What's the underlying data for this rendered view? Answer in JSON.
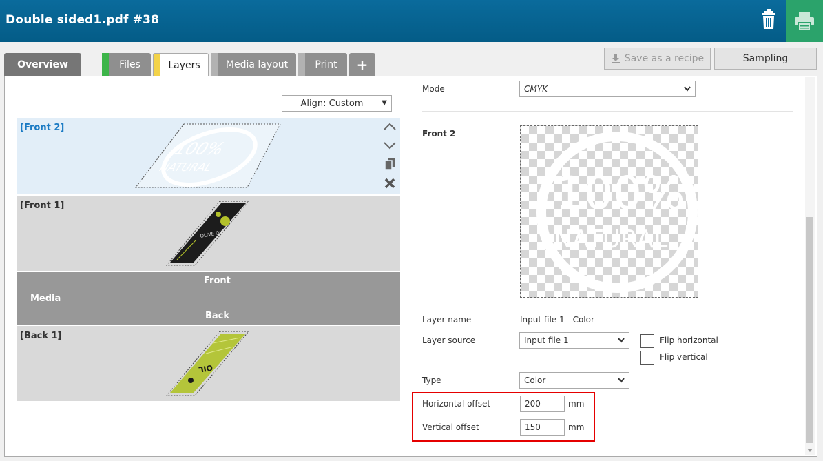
{
  "app": {
    "title": "Double sided1.pdf #38"
  },
  "header": {
    "trash_icon": "trash-icon",
    "print_icon": "printer-icon"
  },
  "tabs": [
    {
      "label": "Overview"
    },
    {
      "label": "Files",
      "color": "#3db54a"
    },
    {
      "label": "Layers",
      "color": "#f3d34a"
    },
    {
      "label": "Media layout",
      "color": "#9b9b9b"
    },
    {
      "label": "Print",
      "color": "#9b9b9b"
    },
    {
      "label": "+"
    }
  ],
  "toolbar": {
    "save_recipe": "Save as a recipe",
    "sampling": "Sampling"
  },
  "left": {
    "align": "Align: Custom",
    "layers": [
      {
        "name": "[Front 2]",
        "selected": true
      },
      {
        "name": "[Front 1]"
      },
      {
        "name": "[Back 1]"
      }
    ],
    "media": {
      "front": "Front",
      "media": "Media",
      "back": "Back"
    },
    "artwork": {
      "natural": "NATURAL",
      "percent": "100%",
      "olive": "OLIVE OIL",
      "olive_back": "OIL"
    }
  },
  "right": {
    "mode_label": "Mode",
    "mode_value": "CMYK",
    "section_title": "Front 2",
    "preview_text_1": "100%",
    "preview_text_2": "NATURAL",
    "layer_name_label": "Layer name",
    "layer_name_value": "Input file 1 - Color",
    "layer_source_label": "Layer source",
    "layer_source_value": "Input file 1",
    "flip_h": "Flip horizontal",
    "flip_v": "Flip vertical",
    "type_label": "Type",
    "type_value": "Color",
    "h_offset_label": "Horizontal offset",
    "h_offset_value": "200",
    "v_offset_label": "Vertical offset",
    "v_offset_value": "150",
    "unit": "mm"
  },
  "colors": {
    "header": "#0a6b9c",
    "print_button": "#2ba36b",
    "highlight": "#e50000",
    "selected_layer": "#e2eef8",
    "selected_text": "#1b7bc4"
  }
}
